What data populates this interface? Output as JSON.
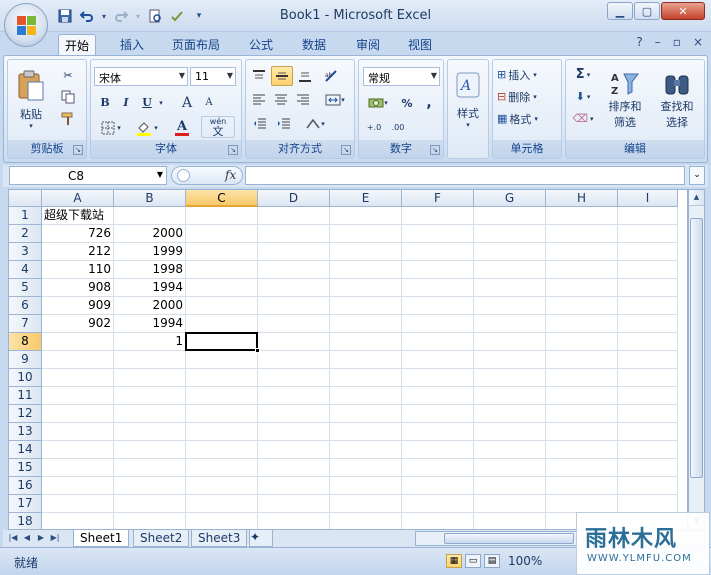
{
  "window": {
    "title": "Book1 - Microsoft Excel"
  },
  "qat": {
    "icons": [
      "save-icon",
      "undo-icon",
      "redo-icon",
      "print-preview-icon",
      "spelling-icon",
      "customize-icon"
    ]
  },
  "tabs": [
    {
      "label": "开始",
      "active": true
    },
    {
      "label": "插入"
    },
    {
      "label": "页面布局"
    },
    {
      "label": "公式"
    },
    {
      "label": "数据"
    },
    {
      "label": "审阅"
    },
    {
      "label": "视图"
    }
  ],
  "ribbon": {
    "clipboard": {
      "label": "剪贴板",
      "paste": "粘贴"
    },
    "font": {
      "label": "字体",
      "name": "宋体",
      "size": "11",
      "bold": "B",
      "italic": "I",
      "underline": "U",
      "grow": "A",
      "shrink": "A",
      "font_color_glyph": "A",
      "phonetic": "wén",
      "phonetic_char": "文"
    },
    "alignment": {
      "label": "对齐方式"
    },
    "number": {
      "label": "数字",
      "format": "常规",
      "percent": "%",
      "comma": ",",
      "inc_decimal": "+.0",
      "dec_decimal": ".00"
    },
    "styles": {
      "label": "样式"
    },
    "cells": {
      "label": "单元格",
      "insert": "插入",
      "delete": "删除",
      "format": "格式"
    },
    "editing": {
      "label": "编辑",
      "sort": "排序和",
      "sort2": "筛选",
      "find": "查找和",
      "find2": "选择",
      "sigma": "Σ"
    }
  },
  "formula_bar": {
    "name_box": "C8",
    "fx": "fx",
    "formula": ""
  },
  "grid": {
    "columns": [
      "A",
      "B",
      "C",
      "D",
      "E",
      "F",
      "G",
      "H",
      "I"
    ],
    "rows": [
      "1",
      "2",
      "3",
      "4",
      "5",
      "6",
      "7",
      "8",
      "9",
      "10",
      "11",
      "12",
      "13",
      "14",
      "15",
      "16",
      "17",
      "18"
    ],
    "selected_cell": "C8",
    "cells": {
      "A1": "超级下载站",
      "A2": "726",
      "B2": "2000",
      "A3": "212",
      "B3": "1999",
      "A4": "110",
      "B4": "1998",
      "A5": "908",
      "B5": "1994",
      "A6": "909",
      "B6": "2000",
      "A7": "902",
      "B7": "1994",
      "B8": "1"
    }
  },
  "sheets": [
    {
      "label": "Sheet1",
      "active": true
    },
    {
      "label": "Sheet2"
    },
    {
      "label": "Sheet3"
    }
  ],
  "status": {
    "text": "就绪",
    "zoom": "100%"
  },
  "watermark": {
    "main": "雨林木风",
    "sub": "WWW.YLMFU.COM"
  },
  "colors": {
    "selection_header": "#f8c96a",
    "ribbon_accent": "#15428b"
  }
}
